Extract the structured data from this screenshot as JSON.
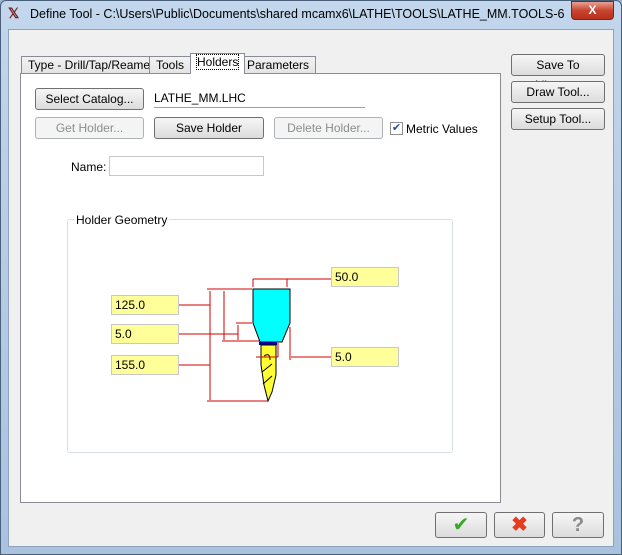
{
  "window": {
    "title": "Define Tool - C:\\Users\\Public\\Documents\\shared mcamx6\\LATHE\\TOOLS\\LATHE_MM.TOOLS-6",
    "close": "X"
  },
  "tabs": [
    {
      "label": "Type - Drill/Tap/Reamer"
    },
    {
      "label": "Tools"
    },
    {
      "label": "Holders",
      "active": true
    },
    {
      "label": "Parameters"
    }
  ],
  "holders": {
    "select_catalog": "Select Catalog...",
    "catalog_file": "LATHE_MM.LHC",
    "get_holder": "Get Holder...",
    "save_holder": "Save Holder",
    "delete_holder": "Delete Holder...",
    "metric_label": "Metric Values",
    "metric_checked": true,
    "name_label": "Name:",
    "name_value": "",
    "geometry_label": "Holder Geometry",
    "geometry": {
      "length": "125.0",
      "taper": "5.0",
      "overall": "155.0",
      "diameter": "50.0",
      "clearance": "5.0"
    }
  },
  "side": {
    "save_library": "Save To Library...",
    "draw_tool": "Draw Tool...",
    "setup_tool": "Setup Tool..."
  },
  "footer": {
    "ok": "ok-check",
    "cancel": "cancel-x",
    "help": "help-question"
  },
  "colors": {
    "holder": "#00ffff",
    "tool": "#ffff33",
    "dim": "#d00000",
    "field": "#ffff99"
  }
}
